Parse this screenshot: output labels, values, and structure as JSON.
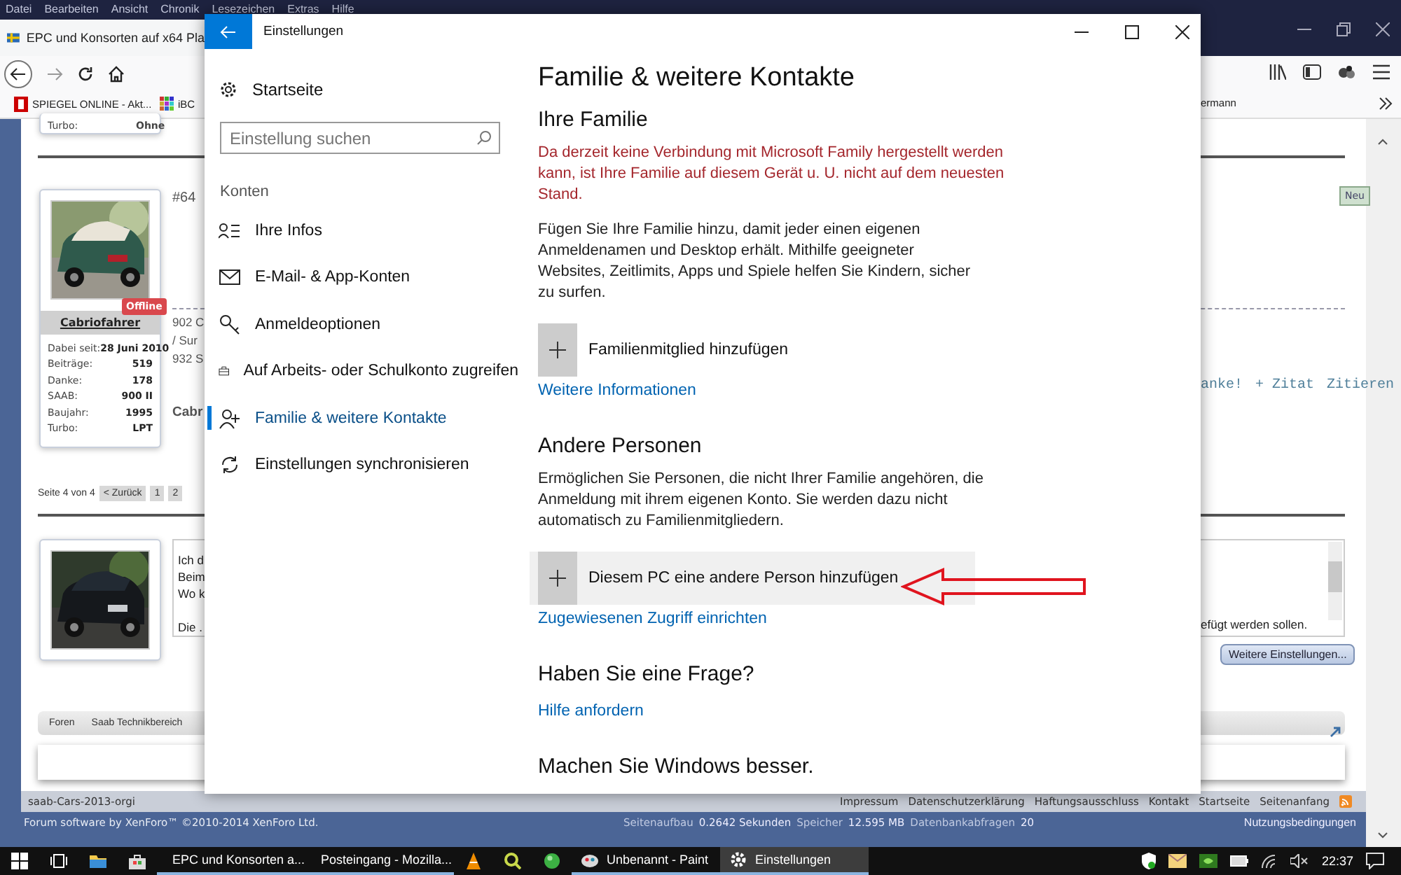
{
  "browser": {
    "menu": [
      "Datei",
      "Bearbeiten",
      "Ansicht",
      "Chronik",
      "Lesezeichen",
      "Extras",
      "Hilfe"
    ],
    "tab_title": "EPC und Konsorten auf x64 Pla",
    "bookmarks": [
      {
        "label": "SPIEGEL ONLINE - Akt..."
      },
      {
        "label": "iBC"
      }
    ],
    "bookmark_right": "ermann"
  },
  "forum": {
    "prev_card": {
      "label": "Turbo:",
      "value": "Ohne"
    },
    "post": {
      "number": "#64",
      "user": "Cabriofahrer",
      "status": "Offline",
      "new_badge": "Neu",
      "stats": [
        {
          "label": "Dabei seit:",
          "value": "28 Juni 2010"
        },
        {
          "label": "Beiträge:",
          "value": "519"
        },
        {
          "label": "Danke:",
          "value": "178"
        },
        {
          "label": "SAAB:",
          "value": "900 II"
        },
        {
          "label": "Baujahr:",
          "value": "1995"
        },
        {
          "label": "Turbo:",
          "value": "LPT"
        }
      ],
      "signature_lines": [
        "902 C",
        "/ Sur",
        "932 S"
      ],
      "signature_name": "Cabr",
      "actions": [
        "anke!",
        "+ Zitat",
        "Zitieren"
      ]
    },
    "pagination": {
      "label": "Seite 4 von 4",
      "prev": "< Zurück",
      "pages": [
        "1",
        "2"
      ]
    },
    "reply": {
      "lines": [
        "Ich d",
        "Beim",
        "Wo k",
        "Die ."
      ],
      "hint": "efügt werden sollen.",
      "more_button": "Weitere Einstellungen..."
    },
    "breadcrumb": [
      "Foren",
      "Saab Technikbereich"
    ],
    "style_name": "saab-Cars-2013-orgi",
    "footer_links": [
      "Impressum",
      "Datenschutzerklärung",
      "Haftungsausschluss",
      "Kontakt",
      "Startseite",
      "Seitenanfang"
    ],
    "credits": "Forum software by XenForo™ ©2010-2014 XenForo Ltd.",
    "stats": [
      {
        "label": "Seitenaufbau",
        "value": "0.2642 Sekunden"
      },
      {
        "label": "Speicher",
        "value": "12.595 MB"
      },
      {
        "label": "Datenbankabfragen",
        "value": "20"
      }
    ],
    "terms": "Nutzungsbedingungen"
  },
  "settings": {
    "title": "Einstellungen",
    "home": "Startseite",
    "search_placeholder": "Einstellung suchen",
    "section": "Konten",
    "nav": [
      {
        "label": "Ihre Infos",
        "selected": false
      },
      {
        "label": "E-Mail- & App-Konten",
        "selected": false
      },
      {
        "label": "Anmeldeoptionen",
        "selected": false
      },
      {
        "label": "Auf Arbeits- oder Schulkonto zugreifen",
        "selected": false
      },
      {
        "label": "Familie & weitere Kontakte",
        "selected": true
      },
      {
        "label": "Einstellungen synchronisieren",
        "selected": false
      }
    ],
    "heading": "Familie & weitere Kontakte",
    "sections": [
      {
        "heading": "Ihre Familie",
        "warning": "Da derzeit keine Verbindung mit Microsoft Family hergestellt werden kann, ist Ihre Familie auf diesem Gerät u. U. nicht auf dem neuesten Stand.",
        "text": "Fügen Sie Ihre Familie hinzu, damit jeder einen eigenen Anmeldenamen und Desktop erhält. Mithilfe geeigneter Websites, Zeitlimits, Apps und Spiele helfen Sie Kindern, sicher zu surfen.",
        "add": {
          "label": "Familienmitglied hinzufügen",
          "highlighted": false
        },
        "link": "Weitere Informationen"
      },
      {
        "heading": "Andere Personen",
        "text": "Ermöglichen Sie Personen, die nicht Ihrer Familie angehören, die Anmeldung mit ihrem eigenen Konto. Sie werden dazu nicht automatisch zu Familienmitgliedern.",
        "add": {
          "label": "Diesem PC eine andere Person hinzufügen",
          "highlighted": true
        },
        "link": "Zugewiesenen Zugriff einrichten"
      },
      {
        "heading": "Haben Sie eine Frage?",
        "link": "Hilfe anfordern"
      },
      {
        "heading": "Machen Sie Windows besser."
      }
    ]
  },
  "taskbar": {
    "apps": [
      {
        "label": "EPC und Konsorten a...",
        "selected": false
      },
      {
        "label": "Posteingang - Mozilla...",
        "selected": false
      },
      {
        "label": "Unbenannt - Paint",
        "selected": false
      },
      {
        "label": "Einstellungen",
        "selected": true
      }
    ],
    "clock": "22:37"
  }
}
